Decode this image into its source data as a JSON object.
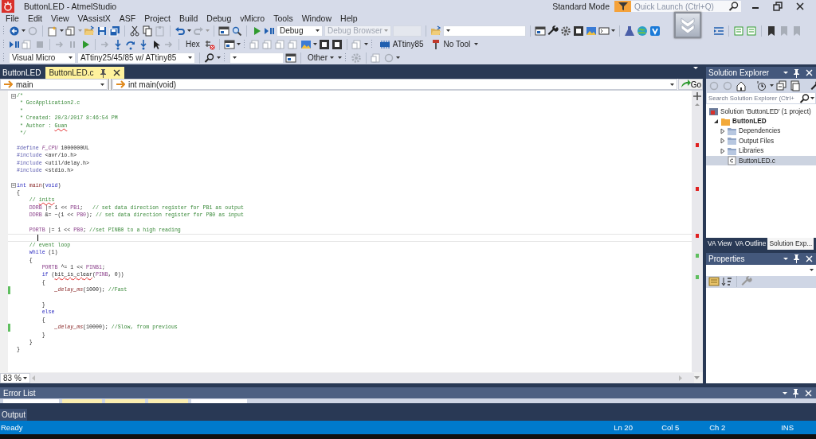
{
  "window": {
    "title": "ButtonLED - AtmelStudio",
    "mode": "Standard Mode",
    "quick_launch": {
      "placeholder": "Quick Launch (Ctrl+Q)"
    }
  },
  "menu": [
    "File",
    "Edit",
    "View",
    "VAssistX",
    "ASF",
    "Project",
    "Build",
    "Debug",
    "vMicro",
    "Tools",
    "Window",
    "Help"
  ],
  "toolbar": {
    "configuration": "Debug",
    "debug_browser": {
      "label": "Debug Browser",
      "disabled": true
    },
    "hex": "Hex",
    "device": "ATtiny85",
    "tool": "No Tool",
    "ide": "Visual Micro",
    "board": "ATtiny25/45/85 w/ ATtiny85",
    "other": "Other"
  },
  "doc_tabs": [
    {
      "label": "ButtonLED",
      "selected": false
    },
    {
      "label": "ButtonLED.c",
      "selected": true
    }
  ],
  "navigation": {
    "scope": "main",
    "member": "int main(void)",
    "go": "Go"
  },
  "editor": {
    "lines": [
      {
        "tokens": [
          {
            "t": "/*",
            "kind": "comment"
          }
        ],
        "fold": true,
        "changed": false,
        "current": false
      },
      {
        "tokens": [
          {
            "t": " * GccApplication2.c",
            "kind": "comment"
          }
        ],
        "changed": false,
        "current": false
      },
      {
        "tokens": [
          {
            "t": " *",
            "kind": "comment"
          }
        ],
        "changed": false,
        "current": false
      },
      {
        "tokens": [
          {
            "t": " * Created: 20/3/2017 8:46:54 PM",
            "kind": "comment"
          }
        ],
        "changed": false,
        "current": false
      },
      {
        "tokens": [
          {
            "t": " * Author : ",
            "kind": "comment"
          },
          {
            "t": "Guan",
            "kind": "comment",
            "flagged": true
          }
        ],
        "changed": false,
        "current": false
      },
      {
        "tokens": [
          {
            "t": " */",
            "kind": "comment"
          }
        ],
        "changed": false,
        "current": false
      },
      {
        "changed": false,
        "current": false
      },
      {
        "tokens": [
          {
            "t": "#define",
            "kind": "preproc"
          },
          {
            "t": " F_CPU",
            "kind": "macro_italic"
          },
          {
            "t": " 1000000UL",
            "kind": "plain"
          }
        ],
        "changed": false,
        "current": false
      },
      {
        "tokens": [
          {
            "t": "#include",
            "kind": "preproc"
          },
          {
            "t": " <avr/io.h>",
            "kind": "plain"
          }
        ],
        "changed": false,
        "current": false
      },
      {
        "tokens": [
          {
            "t": "#include",
            "kind": "preproc"
          },
          {
            "t": " <util/delay.h>",
            "kind": "plain"
          }
        ],
        "changed": false,
        "current": false
      },
      {
        "tokens": [
          {
            "t": "#include",
            "kind": "preproc"
          },
          {
            "t": " <stdio.h>",
            "kind": "plain"
          }
        ],
        "changed": false,
        "current": false
      },
      {
        "changed": false,
        "current": false
      },
      {
        "tokens": [
          {
            "t": "int ",
            "kind": "keyword"
          },
          {
            "t": "main",
            "kind": "function"
          },
          {
            "t": "(",
            "kind": "plain"
          },
          {
            "t": "void",
            "kind": "keyword"
          },
          {
            "t": ")",
            "kind": "plain"
          }
        ],
        "fold": true,
        "changed": false,
        "current": false
      },
      {
        "tokens": [
          {
            "t": "{",
            "kind": "plain"
          }
        ],
        "changed": false,
        "current": false
      },
      {
        "tokens": [
          {
            "t": "    // ",
            "kind": "comment"
          },
          {
            "t": "inits",
            "kind": "comment",
            "flagged": true
          }
        ],
        "changed": false,
        "current": false
      },
      {
        "tokens": [
          {
            "t": "    DDRB",
            "kind": "macro"
          },
          {
            "t": " |= 1 << ",
            "kind": "plain"
          },
          {
            "t": "PB1",
            "kind": "macro"
          },
          {
            "t": ";   ",
            "kind": "plain"
          },
          {
            "t": "// set data direction register for PB1 as output",
            "kind": "comment"
          }
        ],
        "changed": false,
        "current": false
      },
      {
        "tokens": [
          {
            "t": "    DDRB",
            "kind": "macro"
          },
          {
            "t": " &= ~(1 << ",
            "kind": "plain"
          },
          {
            "t": "PB0",
            "kind": "macro"
          },
          {
            "t": "); ",
            "kind": "plain"
          },
          {
            "t": "// set data direction register for PB0 as input",
            "kind": "comment"
          }
        ],
        "changed": false,
        "current": false
      },
      {
        "changed": false,
        "current": false
      },
      {
        "tokens": [
          {
            "t": "    PORTB",
            "kind": "macro"
          },
          {
            "t": " |= 1 << ",
            "kind": "plain"
          },
          {
            "t": "PB0",
            "kind": "macro"
          },
          {
            "t": "; ",
            "kind": "plain"
          },
          {
            "t": "//set PINB0 to a high reading",
            "kind": "comment"
          }
        ],
        "changed": false,
        "current": false
      },
      {
        "changed": false,
        "current": true
      },
      {
        "tokens": [
          {
            "t": "    // event loop",
            "kind": "comment"
          }
        ],
        "changed": false,
        "current": false
      },
      {
        "tokens": [
          {
            "t": "    while",
            "kind": "keyword"
          },
          {
            "t": " (1)",
            "kind": "plain"
          }
        ],
        "changed": false,
        "current": false
      },
      {
        "tokens": [
          {
            "t": "    {",
            "kind": "plain"
          }
        ],
        "changed": false,
        "current": false
      },
      {
        "tokens": [
          {
            "t": "        PORTB",
            "kind": "macro"
          },
          {
            "t": " ^= 1 << ",
            "kind": "plain"
          },
          {
            "t": "PINB1",
            "kind": "macro"
          },
          {
            "t": ";",
            "kind": "plain"
          }
        ],
        "changed": false,
        "current": false
      },
      {
        "tokens": [
          {
            "t": "        if",
            "kind": "keyword"
          },
          {
            "t": " (",
            "kind": "plain"
          },
          {
            "t": "bit_is_clear",
            "kind": "plain",
            "flagged": true
          },
          {
            "t": "(",
            "kind": "plain"
          },
          {
            "t": "PINB",
            "kind": "macro"
          },
          {
            "t": ", 0))",
            "kind": "plain"
          }
        ],
        "changed": false,
        "current": false
      },
      {
        "tokens": [
          {
            "t": "        {",
            "kind": "plain"
          }
        ],
        "changed": false,
        "current": false
      },
      {
        "tokens": [
          {
            "t": "            _delay_ms",
            "kind": "function_italic"
          },
          {
            "t": "(1000); ",
            "kind": "plain"
          },
          {
            "t": "//Fast",
            "kind": "comment"
          }
        ],
        "changed": true,
        "current": false
      },
      {
        "changed": false,
        "current": false
      },
      {
        "tokens": [
          {
            "t": "        }",
            "kind": "plain"
          }
        ],
        "changed": false,
        "current": false
      },
      {
        "tokens": [
          {
            "t": "        else",
            "kind": "keyword"
          }
        ],
        "changed": false,
        "current": false
      },
      {
        "tokens": [
          {
            "t": "        {",
            "kind": "plain"
          }
        ],
        "changed": false,
        "current": false
      },
      {
        "tokens": [
          {
            "t": "            _delay_ms",
            "kind": "function_italic"
          },
          {
            "t": "(10000); ",
            "kind": "plain"
          },
          {
            "t": "//Slow, from previous",
            "kind": "comment"
          }
        ],
        "changed": true,
        "current": false
      },
      {
        "tokens": [
          {
            "t": "        }",
            "kind": "plain"
          }
        ],
        "changed": false,
        "current": false
      },
      {
        "tokens": [
          {
            "t": "    }",
            "kind": "plain"
          }
        ],
        "changed": false,
        "current": false
      },
      {
        "tokens": [
          {
            "t": "}",
            "kind": "plain"
          }
        ],
        "changed": false,
        "current": false
      }
    ],
    "zoom": "83 %"
  },
  "solution_explorer": {
    "title": "Solution Explorer",
    "search": {
      "placeholder": "Search Solution Explorer (Ctrl+"
    },
    "tree": [
      {
        "label": "Solution 'ButtonLED' (1 project)",
        "kind": "solution",
        "selected": false,
        "children": [
          {
            "label": "ButtonLED",
            "kind": "project",
            "expanded": true,
            "selected": false,
            "children": [
              {
                "label": "Dependencies",
                "kind": "folder",
                "expanded": false,
                "selected": false
              },
              {
                "label": "Output Files",
                "kind": "folder",
                "expanded": false,
                "selected": false
              },
              {
                "label": "Libraries",
                "kind": "folder",
                "expanded": false,
                "selected": false
              },
              {
                "label": "ButtonLED.c",
                "kind": "file",
                "selected": true
              }
            ]
          }
        ]
      }
    ],
    "tabs": [
      {
        "label": "VA View",
        "selected": false
      },
      {
        "label": "VA Outline",
        "selected": false
      },
      {
        "label": "Solution Exp...",
        "selected": true
      }
    ]
  },
  "properties": {
    "title": "Properties"
  },
  "error_list": {
    "title": "Error List"
  },
  "output": {
    "title": "Output"
  },
  "status_bar": {
    "message": "Ready",
    "line": "Ln 20",
    "column": "Col 5",
    "char": "Ch 2",
    "mode": "INS"
  }
}
